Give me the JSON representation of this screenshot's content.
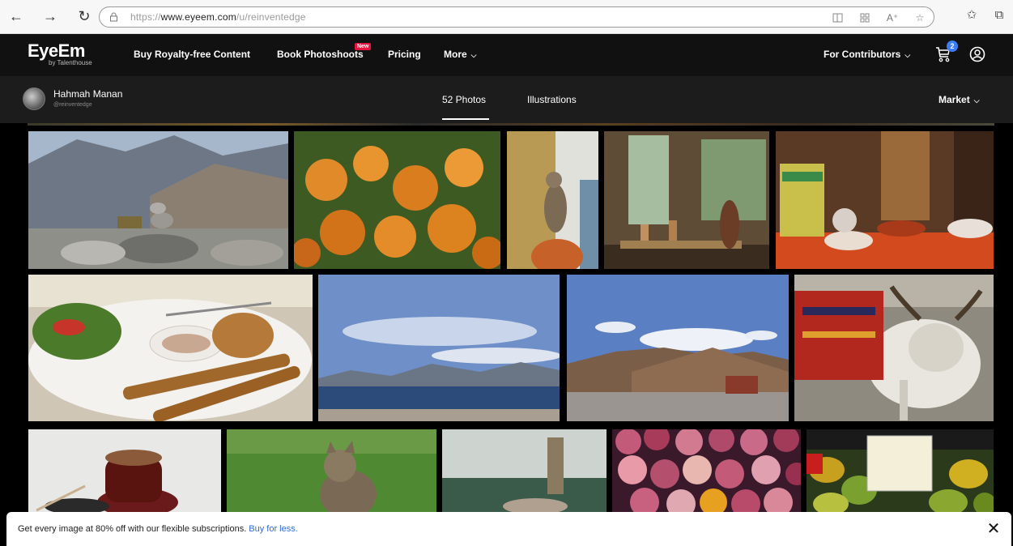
{
  "browser": {
    "url_prefix": "https://",
    "url_domain": "www.eyeem.com",
    "url_path": "/u/reinventedge"
  },
  "site": {
    "logo": "EyeEm",
    "logo_sub": "by Talenthouse",
    "nav": [
      {
        "label": "Buy Royalty-free Content"
      },
      {
        "label": "Book Photoshoots",
        "badge": "New"
      },
      {
        "label": "Pricing"
      },
      {
        "label": "More"
      }
    ],
    "contributors": "For Contributors",
    "cart_count": "2"
  },
  "profile": {
    "name": "Hahmah Manan",
    "handle": "@reinventedge",
    "tabs": [
      "52 Photos",
      "Illustrations"
    ],
    "active_tab": 0,
    "market": "Market"
  },
  "banner": {
    "text": "Get every image at 80% off with our flexible subscriptions.",
    "link": "Buy for less."
  }
}
